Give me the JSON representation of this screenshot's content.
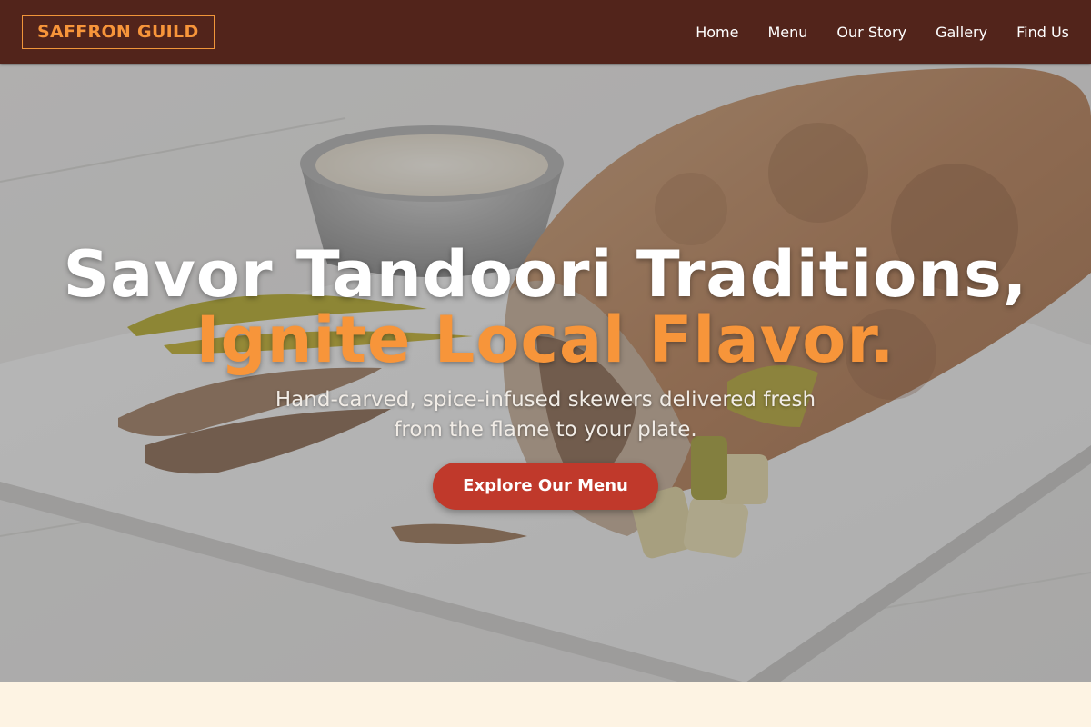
{
  "brand": {
    "logo_text": "SAFFRON GUILD"
  },
  "nav": {
    "items": [
      {
        "label": "Home"
      },
      {
        "label": "Menu"
      },
      {
        "label": "Our Story"
      },
      {
        "label": "Gallery"
      },
      {
        "label": "Find Us"
      }
    ]
  },
  "hero": {
    "title_line1": "Savor Tandoori Traditions,",
    "title_line2": "Ignite Local Flavor.",
    "subtitle": "Hand-carved, spice-infused skewers delivered fresh from the flame to your plate.",
    "cta_label": "Explore Our Menu",
    "image_icon": "shawarma-wrap-photo"
  },
  "colors": {
    "nav_bg": "#52241b",
    "accent": "#f7953a",
    "cta": "#c0392b",
    "page_bg": "#fdf3e3"
  }
}
